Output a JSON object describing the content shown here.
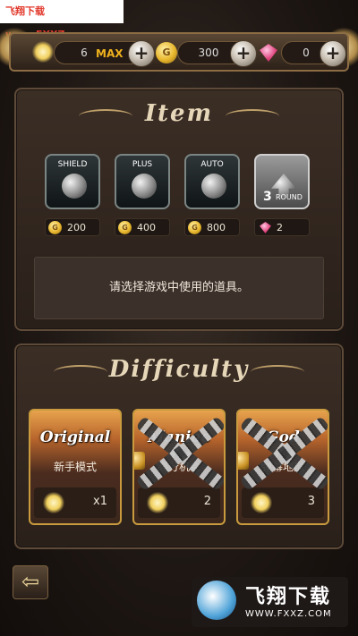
{
  "watermark": {
    "top_text": "飞翔下载 www.FXXZ.com",
    "bottom_title": "飞翔下载",
    "bottom_url": "WWW.FXXZ.COM"
  },
  "resources": {
    "energy": {
      "value": "6",
      "max_label": "MAX",
      "plus": "+"
    },
    "coins": {
      "value": "300",
      "icon_letter": "G",
      "plus": "+"
    },
    "gems": {
      "value": "0",
      "plus": "+"
    }
  },
  "item_panel": {
    "title": "Item",
    "items": [
      {
        "label": "SHIELD",
        "price": "200",
        "currency": "coin"
      },
      {
        "label": "PLUS",
        "price": "400",
        "currency": "coin"
      },
      {
        "label": "AUTO",
        "price": "800",
        "currency": "coin"
      },
      {
        "label": "3",
        "sub": "ROUND",
        "price": "2",
        "currency": "gem"
      }
    ],
    "coin_letter": "G",
    "info_text": "请选择游戏中使用的道具。"
  },
  "difficulty_panel": {
    "title": "Difficulty",
    "cards": [
      {
        "name": "Original",
        "subtitle": "新手模式",
        "cost": "x1",
        "locked": false
      },
      {
        "name": "Maniac",
        "subtitle": "高分机会",
        "cost": "2",
        "locked": true
      },
      {
        "name": "God",
        "subtitle": "弹幕地狱",
        "cost": "3",
        "locked": true
      }
    ]
  },
  "back_button": {
    "glyph": "⇦"
  },
  "colors": {
    "gold": "#c99b3e",
    "max": "#f0b21d",
    "panel": "#2f241d"
  }
}
